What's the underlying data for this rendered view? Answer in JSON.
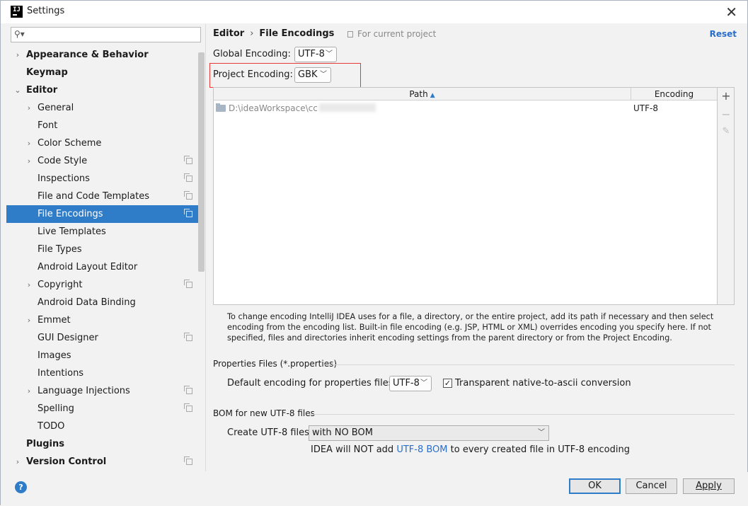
{
  "window": {
    "title": "Settings",
    "icon_text": "IJ"
  },
  "search": {
    "placeholder": ""
  },
  "sidebar": {
    "items": [
      {
        "label": "Appearance & Behavior",
        "level": 0,
        "arrow": "right",
        "bold": true,
        "copy": false
      },
      {
        "label": "Keymap",
        "level": 0,
        "arrow": "",
        "bold": true,
        "copy": false
      },
      {
        "label": "Editor",
        "level": 0,
        "arrow": "down",
        "bold": true,
        "copy": false
      },
      {
        "label": "General",
        "level": 1,
        "arrow": "right",
        "bold": false,
        "copy": false
      },
      {
        "label": "Font",
        "level": 1,
        "arrow": "",
        "bold": false,
        "copy": false
      },
      {
        "label": "Color Scheme",
        "level": 1,
        "arrow": "right",
        "bold": false,
        "copy": false
      },
      {
        "label": "Code Style",
        "level": 1,
        "arrow": "right",
        "bold": false,
        "copy": true
      },
      {
        "label": "Inspections",
        "level": 1,
        "arrow": "",
        "bold": false,
        "copy": true
      },
      {
        "label": "File and Code Templates",
        "level": 1,
        "arrow": "",
        "bold": false,
        "copy": true
      },
      {
        "label": "File Encodings",
        "level": 1,
        "arrow": "",
        "bold": false,
        "copy": true,
        "selected": true
      },
      {
        "label": "Live Templates",
        "level": 1,
        "arrow": "",
        "bold": false,
        "copy": false
      },
      {
        "label": "File Types",
        "level": 1,
        "arrow": "",
        "bold": false,
        "copy": false
      },
      {
        "label": "Android Layout Editor",
        "level": 1,
        "arrow": "",
        "bold": false,
        "copy": false
      },
      {
        "label": "Copyright",
        "level": 1,
        "arrow": "right",
        "bold": false,
        "copy": true
      },
      {
        "label": "Android Data Binding",
        "level": 1,
        "arrow": "",
        "bold": false,
        "copy": false
      },
      {
        "label": "Emmet",
        "level": 1,
        "arrow": "right",
        "bold": false,
        "copy": false
      },
      {
        "label": "GUI Designer",
        "level": 1,
        "arrow": "",
        "bold": false,
        "copy": true
      },
      {
        "label": "Images",
        "level": 1,
        "arrow": "",
        "bold": false,
        "copy": false
      },
      {
        "label": "Intentions",
        "level": 1,
        "arrow": "",
        "bold": false,
        "copy": false
      },
      {
        "label": "Language Injections",
        "level": 1,
        "arrow": "right",
        "bold": false,
        "copy": true
      },
      {
        "label": "Spelling",
        "level": 1,
        "arrow": "",
        "bold": false,
        "copy": true
      },
      {
        "label": "TODO",
        "level": 1,
        "arrow": "",
        "bold": false,
        "copy": false
      },
      {
        "label": "Plugins",
        "level": 0,
        "arrow": "",
        "bold": true,
        "copy": false
      },
      {
        "label": "Version Control",
        "level": 0,
        "arrow": "right",
        "bold": true,
        "copy": true
      }
    ]
  },
  "header": {
    "crumb_parent": "Editor",
    "crumb_sep": "›",
    "crumb_current": "File Encodings",
    "for_project": "For current project",
    "reset": "Reset"
  },
  "global_encoding": {
    "label": "Global Encoding:",
    "value": "UTF-8"
  },
  "project_encoding": {
    "label": "Project Encoding:",
    "value": "GBK"
  },
  "table": {
    "col_path": "Path",
    "col_encoding": "Encoding",
    "rows": [
      {
        "path": "D:\\ideaWorkspace\\cc",
        "encoding": "UTF-8"
      }
    ]
  },
  "tools": {
    "add": "+",
    "remove": "−",
    "edit": "✎"
  },
  "help_text": "To change encoding IntelliJ IDEA uses for a file, a directory, or the entire project, add its path if necessary and then select encoding from the encoding list. Built-in file encoding (e.g. JSP, HTML or XML) overrides encoding you specify here. If not specified, files and directories inherit encoding settings from the parent directory or from the Project Encoding.",
  "properties": {
    "section": "Properties Files (*.properties)",
    "label": "Default encoding for properties files:",
    "value": "UTF-8",
    "checkbox_label": "Transparent native-to-ascii conversion",
    "checked": true
  },
  "bom": {
    "section": "BOM for new UTF-8 files",
    "label": "Create UTF-8 files:",
    "value": "with NO BOM",
    "note_pre": "IDEA will NOT add ",
    "note_link": "UTF-8 BOM",
    "note_post": " to every created file in UTF-8 encoding"
  },
  "footer": {
    "help": "?",
    "ok": "OK",
    "cancel": "Cancel",
    "apply": "Apply"
  },
  "colors": {
    "accent": "#2f7dc9",
    "highlight": "#e53935",
    "link": "#2a6ecb"
  }
}
